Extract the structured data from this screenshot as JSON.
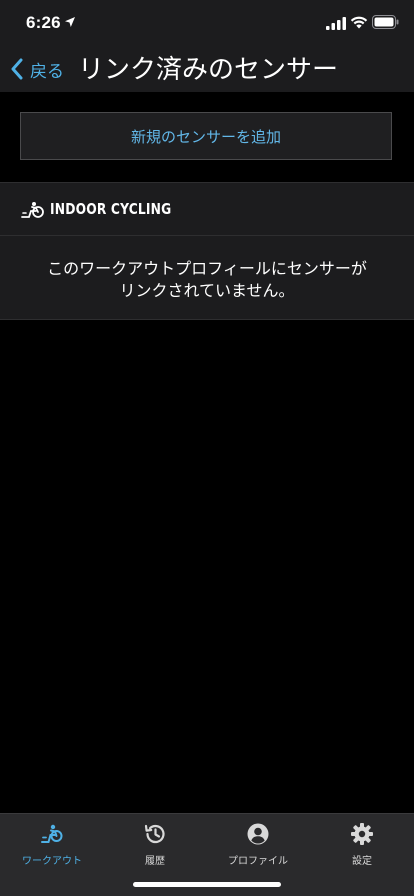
{
  "status_bar": {
    "time": "6:26"
  },
  "nav": {
    "back_label": "戻る",
    "title": "リンク済みのセンサー"
  },
  "main": {
    "add_sensor_label": "新規のセンサーを追加",
    "section_title": "INDOOR CYCLING",
    "empty_message": "このワークアウトプロフィールにセンサーがリンクされていません。"
  },
  "tabs": [
    {
      "label": "ワークアウト",
      "icon": "bike-icon",
      "active": true
    },
    {
      "label": "履歴",
      "icon": "history-icon",
      "active": false
    },
    {
      "label": "プロファイル",
      "icon": "profile-icon",
      "active": false
    },
    {
      "label": "設定",
      "icon": "gear-icon",
      "active": false
    }
  ],
  "colors": {
    "accent": "#4fb1e6",
    "background": "#000000",
    "panel": "#1c1c1e",
    "tab_bar": "#2a2a2c"
  }
}
